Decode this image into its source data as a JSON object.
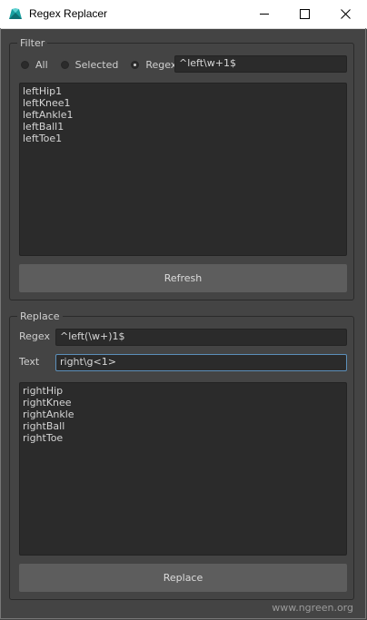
{
  "window": {
    "title": "Regex Replacer"
  },
  "filter": {
    "group_title": "Filter",
    "radios": [
      {
        "label": "All",
        "checked": false
      },
      {
        "label": "Selected",
        "checked": false
      },
      {
        "label": "Regex",
        "checked": true
      }
    ],
    "regex_value": "^left\\w+1$",
    "items": [
      "leftHip1",
      "leftKnee1",
      "leftAnkle1",
      "leftBall1",
      "leftToe1"
    ],
    "refresh_label": "Refresh"
  },
  "replace": {
    "group_title": "Replace",
    "regex_label": "Regex",
    "regex_value": "^left(\\w+)1$",
    "text_label": "Text",
    "text_value": "right\\g<1>",
    "items": [
      "rightHip",
      "rightKnee",
      "rightAnkle",
      "rightBall",
      "rightToe"
    ],
    "replace_label": "Replace"
  },
  "footer": {
    "credit": "www.ngreen.org"
  },
  "colors": {
    "background": "#444444",
    "field": "#2b2b2b",
    "button": "#5d5d5d",
    "focus": "#5c8fba",
    "icon": "#19a0a0"
  }
}
